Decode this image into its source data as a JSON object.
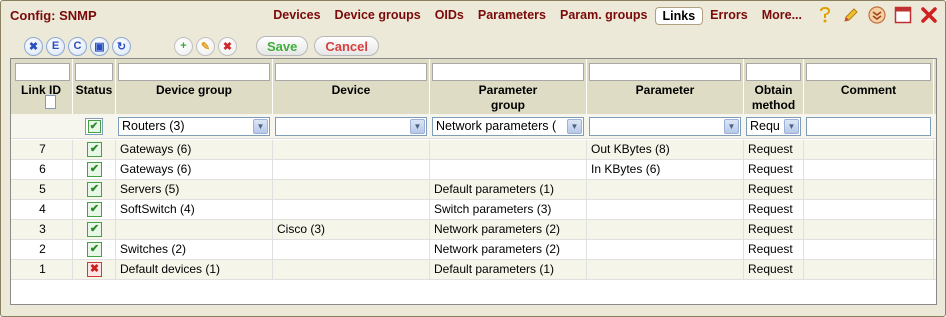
{
  "app": {
    "title": "Config: SNMP"
  },
  "nav": {
    "tabs": [
      {
        "label": "Devices",
        "active": false
      },
      {
        "label": "Device groups",
        "active": false
      },
      {
        "label": "OIDs",
        "active": false
      },
      {
        "label": "Parameters",
        "active": false
      },
      {
        "label": "Param. groups",
        "active": false
      },
      {
        "label": "Links",
        "active": true
      },
      {
        "label": "Errors",
        "active": false
      },
      {
        "label": "More...",
        "active": false
      }
    ]
  },
  "window_icons": [
    "help-icon",
    "edit-pencil-icon",
    "collapse-icon",
    "maximize-icon",
    "close-icon"
  ],
  "toolbar": {
    "round_buttons": [
      {
        "icon": "delete-x-icon",
        "glyph": "✖"
      },
      {
        "icon": "export-e-icon",
        "glyph": "E"
      },
      {
        "icon": "copy-c-icon",
        "glyph": "C"
      },
      {
        "icon": "save-disk-icon",
        "glyph": "▣"
      },
      {
        "icon": "refresh-icon",
        "glyph": "↻"
      }
    ],
    "action_buttons": [
      {
        "icon": "add-icon",
        "glyph": "+"
      },
      {
        "icon": "edit-icon",
        "glyph": "✎"
      },
      {
        "icon": "remove-icon",
        "glyph": "✖"
      }
    ],
    "save_label": "Save",
    "cancel_label": "Cancel"
  },
  "table": {
    "columns": [
      {
        "key": "link_id",
        "label": "Link ID"
      },
      {
        "key": "status",
        "label": "Status"
      },
      {
        "key": "device_group",
        "label": "Device group"
      },
      {
        "key": "device",
        "label": "Device"
      },
      {
        "key": "parameter_group",
        "label": "Parameter group"
      },
      {
        "key": "parameter",
        "label": "Parameter"
      },
      {
        "key": "obtain_method",
        "label": "Obtain method"
      },
      {
        "key": "comment",
        "label": "Comment"
      }
    ],
    "filters": {
      "status_checked": true,
      "device_group": "Routers (3)",
      "device": "",
      "parameter_group": "Network parameters (",
      "parameter": "",
      "obtain_method": "Requ",
      "comment": ""
    },
    "rows": [
      {
        "link_id": "7",
        "status": true,
        "device_group": "Gateways (6)",
        "device": "",
        "parameter_group": "",
        "parameter": "Out KBytes (8)",
        "obtain_method": "Request",
        "comment": ""
      },
      {
        "link_id": "6",
        "status": true,
        "device_group": "Gateways (6)",
        "device": "",
        "parameter_group": "",
        "parameter": "In KBytes (6)",
        "obtain_method": "Request",
        "comment": ""
      },
      {
        "link_id": "5",
        "status": true,
        "device_group": "Servers (5)",
        "device": "",
        "parameter_group": "Default parameters (1)",
        "parameter": "",
        "obtain_method": "Request",
        "comment": ""
      },
      {
        "link_id": "4",
        "status": true,
        "device_group": "SoftSwitch (4)",
        "device": "",
        "parameter_group": "Switch parameters (3)",
        "parameter": "",
        "obtain_method": "Request",
        "comment": ""
      },
      {
        "link_id": "3",
        "status": true,
        "device_group": "",
        "device": "Cisco (3)",
        "parameter_group": "Network parameters (2)",
        "parameter": "",
        "obtain_method": "Request",
        "comment": ""
      },
      {
        "link_id": "2",
        "status": true,
        "device_group": "Switches (2)",
        "device": "",
        "parameter_group": "Network parameters (2)",
        "parameter": "",
        "obtain_method": "Request",
        "comment": ""
      },
      {
        "link_id": "1",
        "status": false,
        "device_group": "Default devices (1)",
        "device": "",
        "parameter_group": "Default parameters (1)",
        "parameter": "",
        "obtain_method": "Request",
        "comment": ""
      }
    ]
  },
  "colors": {
    "accent": "#7a0a0a",
    "header_bg": "#dedcc4",
    "ok": "#2a8a2a",
    "error": "#cc2020"
  }
}
